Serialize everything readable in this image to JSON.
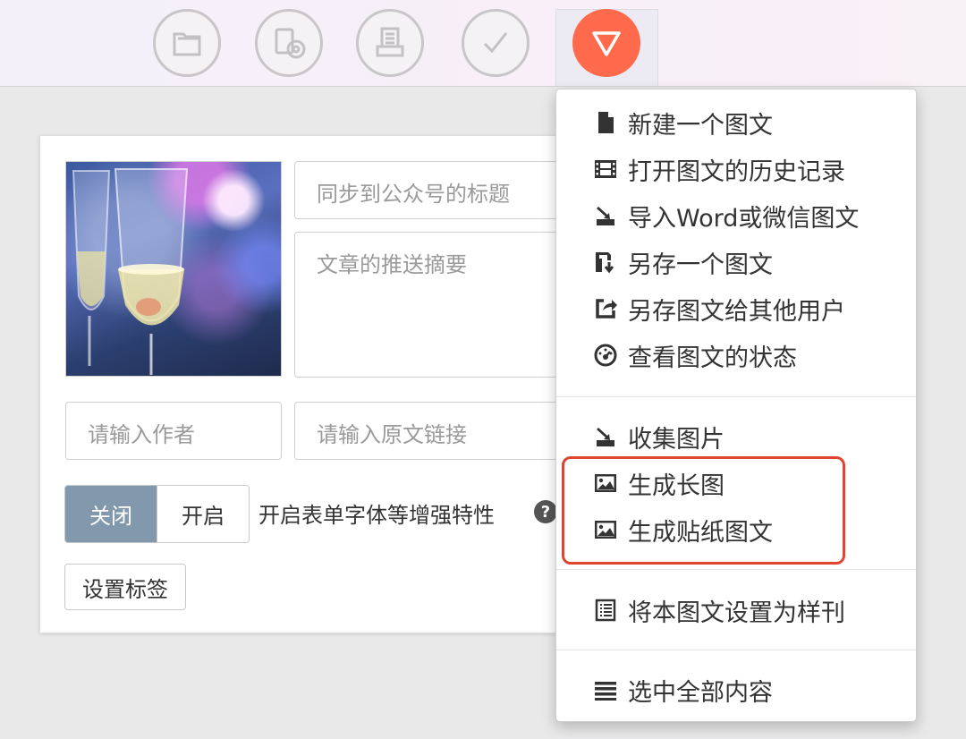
{
  "toolbar": {
    "tools": [
      {
        "icon": "folder-icon"
      },
      {
        "icon": "media-disc-icon"
      },
      {
        "icon": "printer-icon"
      },
      {
        "icon": "check-icon"
      },
      {
        "icon": "dropdown-triangle-icon",
        "active": true
      }
    ],
    "active_color": "#ff6a4d"
  },
  "editor": {
    "title_placeholder": "同步到公众号的标题",
    "summary_placeholder": "文章的推送摘要",
    "author_placeholder": "请输入作者",
    "source_link_placeholder": "请输入原文链接",
    "toggle": {
      "off_label": "关闭",
      "on_label": "开启",
      "selected": "关闭"
    },
    "enhance_label": "开启表单字体等增强特性",
    "help_icon_label": "?",
    "set_tags_label": "设置标签"
  },
  "menu": {
    "groups": [
      [
        {
          "label": "新建一个图文",
          "icon": "file-icon"
        },
        {
          "label": "打开图文的历史记录",
          "icon": "film-icon"
        },
        {
          "label": "导入Word或微信图文",
          "icon": "import-icon"
        },
        {
          "label": "另存一个图文",
          "icon": "save-as-icon"
        },
        {
          "label": "另存图文给其他用户",
          "icon": "share-icon"
        },
        {
          "label": "查看图文的状态",
          "icon": "dashboard-icon"
        }
      ],
      [
        {
          "label": "收集图片",
          "icon": "import-icon"
        },
        {
          "label": "生成长图",
          "icon": "image-icon"
        },
        {
          "label": "生成贴纸图文",
          "icon": "image-icon"
        }
      ],
      [
        {
          "label": "将本图文设置为样刊",
          "icon": "list-icon"
        }
      ],
      [
        {
          "label": "选中全部内容",
          "icon": "bars-icon"
        }
      ]
    ],
    "highlight_color": "#e0452f"
  }
}
